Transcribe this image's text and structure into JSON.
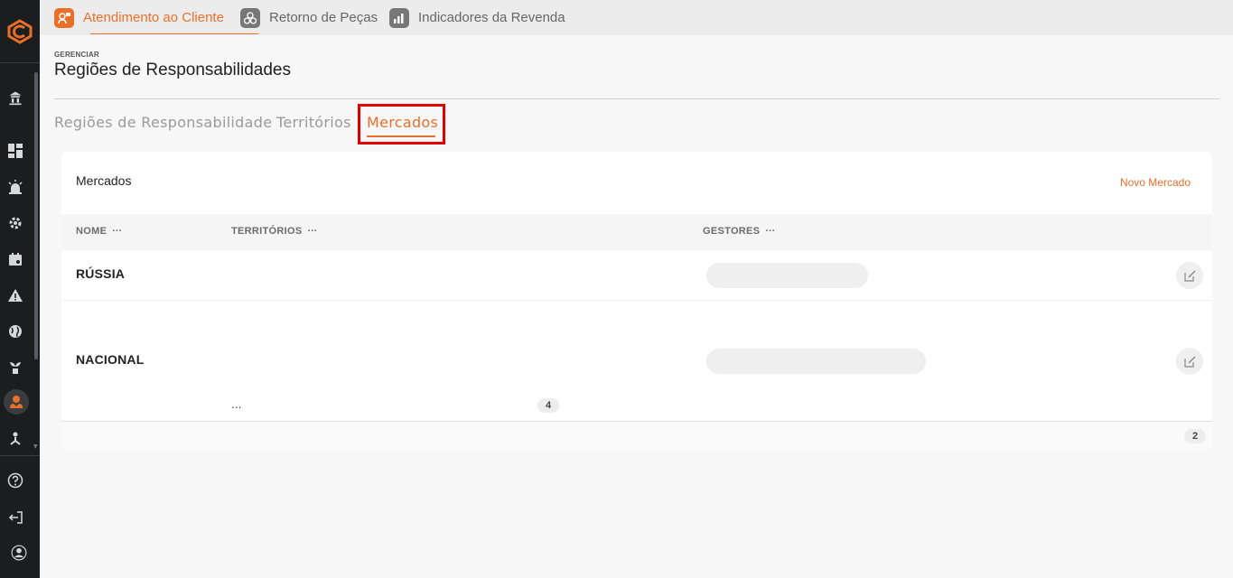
{
  "topnav": {
    "tabs": [
      {
        "label": "Atendimento ao Cliente",
        "icon": "customer-service-icon",
        "active": true
      },
      {
        "label": "Retorno de Peças",
        "icon": "parts-return-icon",
        "active": false
      },
      {
        "label": "Indicadores da Revenda",
        "icon": "chart-icon",
        "active": false
      }
    ]
  },
  "header": {
    "breadcrumb": "GERENCIAR",
    "title": "Regiões de Responsabilidades"
  },
  "subtabs": {
    "items": [
      {
        "label": "Regiões de Responsabilidade"
      },
      {
        "label": "Territórios"
      },
      {
        "label": "Mercados"
      }
    ],
    "active": "Mercados"
  },
  "card": {
    "title": "Mercados",
    "action_label": "Novo Mercado",
    "columns": [
      {
        "label": "NOME",
        "menu": "···"
      },
      {
        "label": "TERRITÓRIOS",
        "menu": "···"
      },
      {
        "label": "GESTORES",
        "menu": "···"
      }
    ],
    "rows": [
      {
        "name": "RÚSSIA"
      },
      {
        "name": "NACIONAL"
      }
    ],
    "territories_more": "...",
    "territories_count": "4",
    "total_count": "2"
  },
  "colors": {
    "accent": "#e8702a",
    "sidebar": "#1b1d1f",
    "highlight": "#e00000"
  }
}
